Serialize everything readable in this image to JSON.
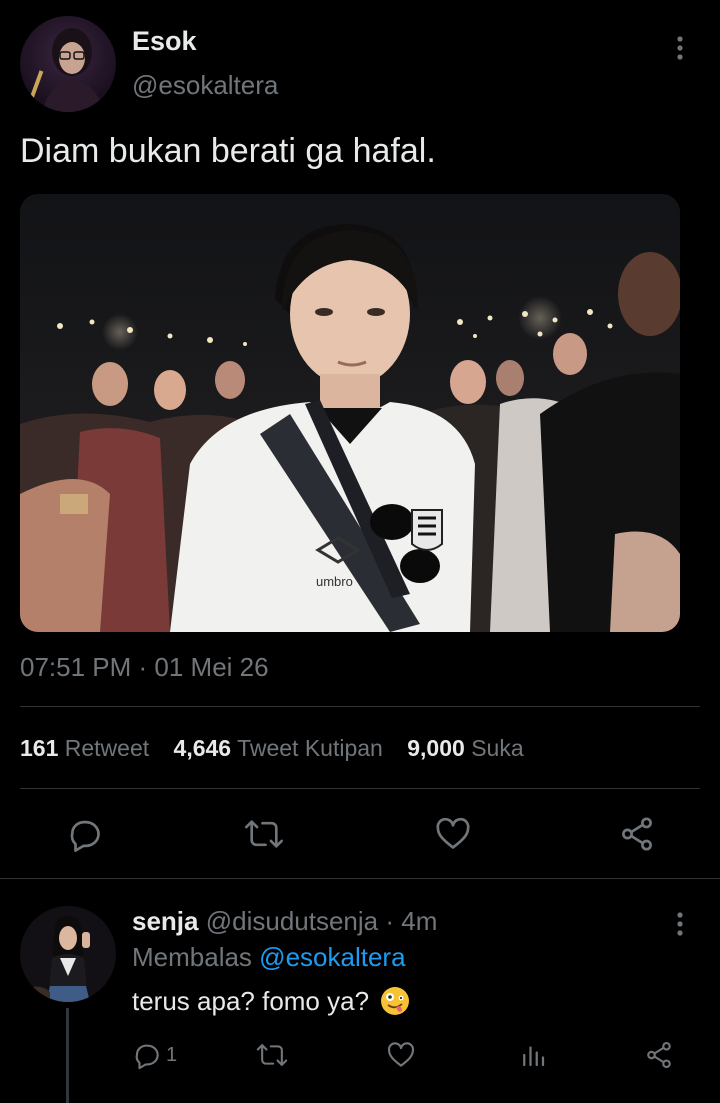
{
  "tweet": {
    "author_name": "Esok",
    "author_handle": "@esokaltera",
    "text": "Diam bukan berati ga hafal.",
    "timestamp": "07:51 PM · 01 Mei 26",
    "photo_shirt_text": "umbro",
    "stats": {
      "retweets_count": "161",
      "retweets_label": "Retweet",
      "quotes_count": "4,646",
      "quotes_label": "Tweet Kutipan",
      "likes_count": "9,000",
      "likes_label": "Suka"
    },
    "actions": [
      "reply-icon",
      "retweet-icon",
      "like-icon",
      "share-icon"
    ]
  },
  "reply": {
    "author_name": "senja",
    "author_handle": "@disudutsenja",
    "time": "· 4m",
    "replying_prefix": "Membalas",
    "replying_to": "@esokaltera",
    "text": "terus apa? fomo ya?",
    "emoji": "🤪",
    "reply_count": "1",
    "actions": [
      "reply-icon",
      "retweet-icon",
      "like-icon",
      "analytics-icon",
      "share-icon"
    ]
  },
  "colors": {
    "background": "#000000",
    "text": "#e7e9ea",
    "muted": "#71767b",
    "link": "#1d9bf0",
    "divider": "#2f3336"
  }
}
